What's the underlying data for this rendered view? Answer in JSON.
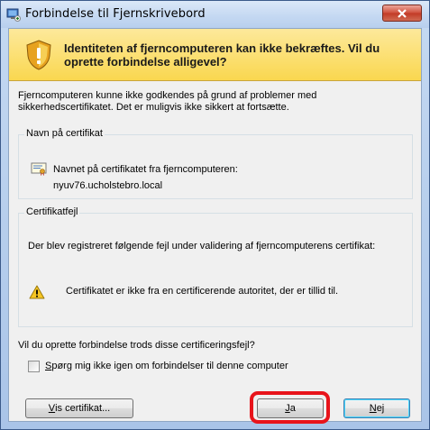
{
  "window": {
    "title": "Forbindelse til Fjernskrivebord",
    "icon": "remote-desktop-icon",
    "close_icon": "close-icon"
  },
  "banner": {
    "icon": "shield-warning-icon",
    "heading": "Identiteten af fjerncomputeren kan ikke bekræftes. Vil du oprette forbindelse alligevel?"
  },
  "intro_text": "Fjerncomputeren kunne ikke godkendes på grund af problemer med sikkerhedscertifikatet. Det er muligvis ikke sikkert at fortsætte.",
  "cert_name_group": {
    "legend": "Navn på certifikat",
    "icon": "certificate-icon",
    "line1": "Navnet på certifikatet fra fjerncomputeren:",
    "line2": "nyuv76.ucholstebro.local"
  },
  "cert_error_group": {
    "legend": "Certifikatfejl",
    "description": "Der blev registreret følgende fejl under validering af fjerncomputerens certifikat:",
    "error_icon": "warning-icon",
    "error_text": "Certifikatet er ikke fra en certificerende autoritet, der er tillid til."
  },
  "question": "Vil du oprette forbindelse trods disse certificeringsfejl?",
  "checkbox": {
    "label_accel": "S",
    "label_rest": "pørg mig ikke igen om forbindelser til denne computer",
    "checked": false
  },
  "buttons": {
    "view_cert_accel": "V",
    "view_cert_rest": "is certifikat...",
    "yes_accel": "J",
    "yes_rest": "a",
    "no_accel": "N",
    "no_rest": "ej"
  },
  "colors": {
    "banner": "#fad74f",
    "highlight": "#e8141b"
  }
}
